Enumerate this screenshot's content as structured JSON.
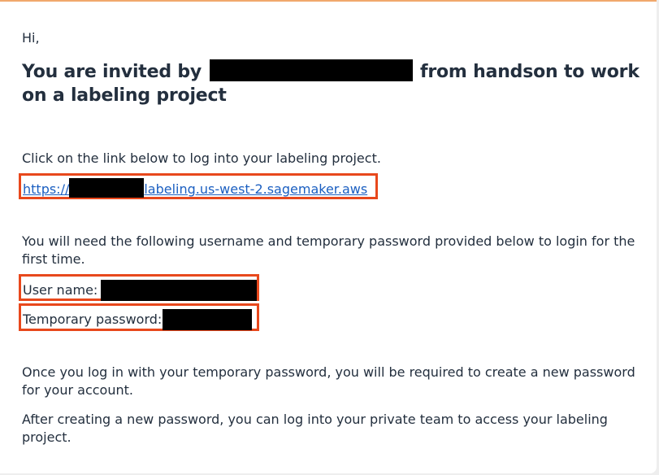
{
  "email": {
    "greeting": "Hi,",
    "heading_before": "You are invited by",
    "heading_after": "from handson to work on a labeling project",
    "click_instruction": "Click on the link below to log into your labeling project.",
    "link_prefix": "https://",
    "link_suffix": "labeling.us-west-2.sagemaker.aws",
    "credentials_instruction": "You will need the following username and temporary password provided below to login for the first time.",
    "username_label": "User name:",
    "password_label": "Temporary password:",
    "once_logged_in": "Once you log in with your temporary password, you will be required to create a new password for your account.",
    "after_creating": "After creating a new password, you can log into your private team to access your labeling project."
  },
  "colors": {
    "highlight_border": "#e8481c",
    "link": "#1b5fc1",
    "top_rule": "#f1a86c",
    "redaction": "#000000"
  }
}
